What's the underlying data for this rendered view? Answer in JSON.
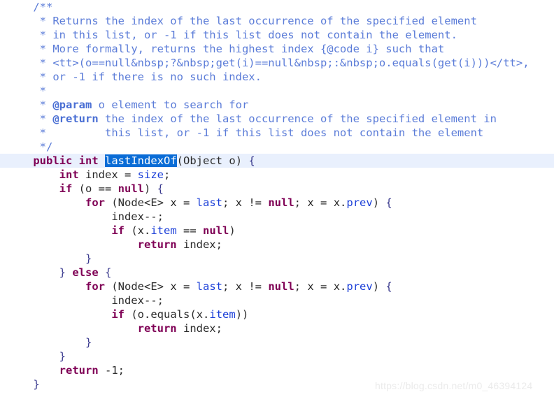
{
  "editor": {
    "language": "java",
    "colors": {
      "background": "#ffffff",
      "comment": "#5b7cd8",
      "keyword": "#7f0055",
      "field": "#1a3ed8",
      "identifier": "#2b2b2b",
      "selection_bg": "#0a6cd6",
      "selection_fg": "#ffffff",
      "current_line_bg": "#e9f0fd",
      "watermark": "#ebebeb"
    },
    "selected_text": "lastIndexOf",
    "watermark": "https://blog.csdn.net/m0_46394124",
    "lines": [
      {
        "n": 1,
        "indent": "    ",
        "current": false,
        "tokens": [
          {
            "t": "/**",
            "c": "cmt"
          }
        ]
      },
      {
        "n": 2,
        "indent": "     ",
        "current": false,
        "tokens": [
          {
            "t": "* Returns the index of the last occurrence of the specified element",
            "c": "cmt"
          }
        ]
      },
      {
        "n": 3,
        "indent": "     ",
        "current": false,
        "tokens": [
          {
            "t": "* in this list, or -1 if this list does not contain the element.",
            "c": "cmt"
          }
        ]
      },
      {
        "n": 4,
        "indent": "     ",
        "current": false,
        "tokens": [
          {
            "t": "* More formally, returns the highest index {@code i} such that",
            "c": "cmt"
          }
        ]
      },
      {
        "n": 5,
        "indent": "     ",
        "current": false,
        "tokens": [
          {
            "t": "* <tt>(o==null&nbsp;?&nbsp;get(i)==null&nbsp;:&nbsp;o.equals(get(i)))</tt>,",
            "c": "cmt"
          }
        ]
      },
      {
        "n": 6,
        "indent": "     ",
        "current": false,
        "tokens": [
          {
            "t": "* or -1 if there is no such index.",
            "c": "cmt"
          }
        ]
      },
      {
        "n": 7,
        "indent": "     ",
        "current": false,
        "tokens": [
          {
            "t": "*",
            "c": "cmt"
          }
        ]
      },
      {
        "n": 8,
        "indent": "     ",
        "current": false,
        "tokens": [
          {
            "t": "* ",
            "c": "cmt"
          },
          {
            "t": "@param",
            "c": "cmt-tag"
          },
          {
            "t": " o element to search for",
            "c": "cmt"
          }
        ]
      },
      {
        "n": 9,
        "indent": "     ",
        "current": false,
        "tokens": [
          {
            "t": "* ",
            "c": "cmt"
          },
          {
            "t": "@return",
            "c": "cmt-tag"
          },
          {
            "t": " the index of the last occurrence of the specified element in",
            "c": "cmt"
          }
        ]
      },
      {
        "n": 10,
        "indent": "     ",
        "current": false,
        "tokens": [
          {
            "t": "*         this list, or -1 if this list does not contain the element",
            "c": "cmt"
          }
        ]
      },
      {
        "n": 11,
        "indent": "     ",
        "current": false,
        "tokens": [
          {
            "t": "*/",
            "c": "cmt"
          }
        ]
      },
      {
        "n": 12,
        "indent": "    ",
        "current": true,
        "tokens": [
          {
            "t": "public",
            "c": "kw"
          },
          {
            "t": " ",
            "c": "pun"
          },
          {
            "t": "int",
            "c": "kw"
          },
          {
            "t": " ",
            "c": "pun"
          },
          {
            "t": "lastIndexOf",
            "c": "sel"
          },
          {
            "t": "(",
            "c": "pun"
          },
          {
            "t": "Object",
            "c": "id"
          },
          {
            "t": " ",
            "c": "pun"
          },
          {
            "t": "o",
            "c": "id"
          },
          {
            "t": ") ",
            "c": "pun"
          },
          {
            "t": "{",
            "c": "brace"
          }
        ]
      },
      {
        "n": 13,
        "indent": "        ",
        "current": false,
        "tokens": [
          {
            "t": "int",
            "c": "kw"
          },
          {
            "t": " ",
            "c": "pun"
          },
          {
            "t": "index",
            "c": "id"
          },
          {
            "t": " = ",
            "c": "pun"
          },
          {
            "t": "size",
            "c": "fld"
          },
          {
            "t": ";",
            "c": "pun"
          }
        ]
      },
      {
        "n": 14,
        "indent": "        ",
        "current": false,
        "tokens": [
          {
            "t": "if",
            "c": "kw"
          },
          {
            "t": " (",
            "c": "pun"
          },
          {
            "t": "o",
            "c": "id"
          },
          {
            "t": " == ",
            "c": "pun"
          },
          {
            "t": "null",
            "c": "kw"
          },
          {
            "t": ") ",
            "c": "pun"
          },
          {
            "t": "{",
            "c": "brace"
          }
        ]
      },
      {
        "n": 15,
        "indent": "            ",
        "current": false,
        "tokens": [
          {
            "t": "for",
            "c": "kw"
          },
          {
            "t": " (",
            "c": "pun"
          },
          {
            "t": "Node<E>",
            "c": "id"
          },
          {
            "t": " ",
            "c": "pun"
          },
          {
            "t": "x",
            "c": "id"
          },
          {
            "t": " = ",
            "c": "pun"
          },
          {
            "t": "last",
            "c": "fld"
          },
          {
            "t": "; ",
            "c": "pun"
          },
          {
            "t": "x",
            "c": "id"
          },
          {
            "t": " != ",
            "c": "pun"
          },
          {
            "t": "null",
            "c": "kw"
          },
          {
            "t": "; ",
            "c": "pun"
          },
          {
            "t": "x",
            "c": "id"
          },
          {
            "t": " = ",
            "c": "pun"
          },
          {
            "t": "x",
            "c": "id"
          },
          {
            "t": ".",
            "c": "pun"
          },
          {
            "t": "prev",
            "c": "fld"
          },
          {
            "t": ") ",
            "c": "pun"
          },
          {
            "t": "{",
            "c": "brace"
          }
        ]
      },
      {
        "n": 16,
        "indent": "                ",
        "current": false,
        "tokens": [
          {
            "t": "index",
            "c": "id"
          },
          {
            "t": "--;",
            "c": "pun"
          }
        ]
      },
      {
        "n": 17,
        "indent": "                ",
        "current": false,
        "tokens": [
          {
            "t": "if",
            "c": "kw"
          },
          {
            "t": " (",
            "c": "pun"
          },
          {
            "t": "x",
            "c": "id"
          },
          {
            "t": ".",
            "c": "pun"
          },
          {
            "t": "item",
            "c": "fld"
          },
          {
            "t": " == ",
            "c": "pun"
          },
          {
            "t": "null",
            "c": "kw"
          },
          {
            "t": ")",
            "c": "pun"
          }
        ]
      },
      {
        "n": 18,
        "indent": "                    ",
        "current": false,
        "tokens": [
          {
            "t": "return",
            "c": "kw"
          },
          {
            "t": " ",
            "c": "pun"
          },
          {
            "t": "index",
            "c": "id"
          },
          {
            "t": ";",
            "c": "pun"
          }
        ]
      },
      {
        "n": 19,
        "indent": "            ",
        "current": false,
        "tokens": [
          {
            "t": "}",
            "c": "brace"
          }
        ]
      },
      {
        "n": 20,
        "indent": "        ",
        "current": false,
        "tokens": [
          {
            "t": "}",
            "c": "brace"
          },
          {
            "t": " ",
            "c": "pun"
          },
          {
            "t": "else",
            "c": "kw"
          },
          {
            "t": " ",
            "c": "pun"
          },
          {
            "t": "{",
            "c": "brace"
          }
        ]
      },
      {
        "n": 21,
        "indent": "            ",
        "current": false,
        "tokens": [
          {
            "t": "for",
            "c": "kw"
          },
          {
            "t": " (",
            "c": "pun"
          },
          {
            "t": "Node<E>",
            "c": "id"
          },
          {
            "t": " ",
            "c": "pun"
          },
          {
            "t": "x",
            "c": "id"
          },
          {
            "t": " = ",
            "c": "pun"
          },
          {
            "t": "last",
            "c": "fld"
          },
          {
            "t": "; ",
            "c": "pun"
          },
          {
            "t": "x",
            "c": "id"
          },
          {
            "t": " != ",
            "c": "pun"
          },
          {
            "t": "null",
            "c": "kw"
          },
          {
            "t": "; ",
            "c": "pun"
          },
          {
            "t": "x",
            "c": "id"
          },
          {
            "t": " = ",
            "c": "pun"
          },
          {
            "t": "x",
            "c": "id"
          },
          {
            "t": ".",
            "c": "pun"
          },
          {
            "t": "prev",
            "c": "fld"
          },
          {
            "t": ") ",
            "c": "pun"
          },
          {
            "t": "{",
            "c": "brace"
          }
        ]
      },
      {
        "n": 22,
        "indent": "                ",
        "current": false,
        "tokens": [
          {
            "t": "index",
            "c": "id"
          },
          {
            "t": "--;",
            "c": "pun"
          }
        ]
      },
      {
        "n": 23,
        "indent": "                ",
        "current": false,
        "tokens": [
          {
            "t": "if",
            "c": "kw"
          },
          {
            "t": " (",
            "c": "pun"
          },
          {
            "t": "o",
            "c": "id"
          },
          {
            "t": ".",
            "c": "pun"
          },
          {
            "t": "equals",
            "c": "id"
          },
          {
            "t": "(",
            "c": "pun"
          },
          {
            "t": "x",
            "c": "id"
          },
          {
            "t": ".",
            "c": "pun"
          },
          {
            "t": "item",
            "c": "fld"
          },
          {
            "t": "))",
            "c": "pun"
          }
        ]
      },
      {
        "n": 24,
        "indent": "                    ",
        "current": false,
        "tokens": [
          {
            "t": "return",
            "c": "kw"
          },
          {
            "t": " ",
            "c": "pun"
          },
          {
            "t": "index",
            "c": "id"
          },
          {
            "t": ";",
            "c": "pun"
          }
        ]
      },
      {
        "n": 25,
        "indent": "            ",
        "current": false,
        "tokens": [
          {
            "t": "}",
            "c": "brace"
          }
        ]
      },
      {
        "n": 26,
        "indent": "        ",
        "current": false,
        "tokens": [
          {
            "t": "}",
            "c": "brace"
          }
        ]
      },
      {
        "n": 27,
        "indent": "        ",
        "current": false,
        "tokens": [
          {
            "t": "return",
            "c": "kw"
          },
          {
            "t": " ",
            "c": "pun"
          },
          {
            "t": "-1",
            "c": "id"
          },
          {
            "t": ";",
            "c": "pun"
          }
        ]
      },
      {
        "n": 28,
        "indent": "    ",
        "current": false,
        "tokens": [
          {
            "t": "}",
            "c": "brace"
          }
        ]
      }
    ]
  }
}
